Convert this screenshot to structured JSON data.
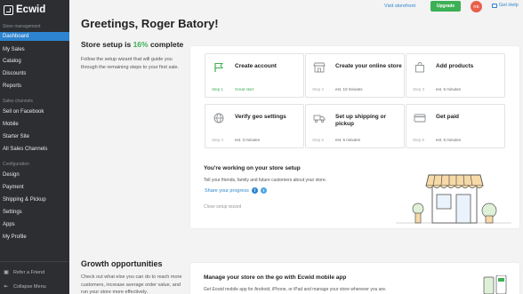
{
  "sidebar": {
    "brand": "Ecwid",
    "sections": {
      "store_management": "Store management",
      "sales_channels": "Sales channels",
      "configuration": "Configuration"
    },
    "items": [
      {
        "label": "Dashboard",
        "active": true
      },
      {
        "label": "My Sales"
      },
      {
        "label": "Catalog"
      },
      {
        "label": "Discounts"
      },
      {
        "label": "Reports"
      },
      {
        "label": "Sell on Facebook"
      },
      {
        "label": "Mobile"
      },
      {
        "label": "Starter Site"
      },
      {
        "label": "All Sales Channels"
      },
      {
        "label": "Design"
      },
      {
        "label": "Payment"
      },
      {
        "label": "Shipping & Pickup"
      },
      {
        "label": "Settings"
      },
      {
        "label": "Apps"
      },
      {
        "label": "My Profile"
      }
    ],
    "refer_friend": "Refer a Friend",
    "collapse_menu": "Collapse Menu"
  },
  "topbar": {
    "visit_storefront": "Visit storefront",
    "upgrade": "Upgrade",
    "avatar_initials": "RB",
    "get_help": "Get Help"
  },
  "greeting": "Greetings, Roger Batory!",
  "setup": {
    "title_prefix": "Store setup is ",
    "percent": "16%",
    "title_suffix": " complete",
    "description": "Follow the setup wizard that will guide you through the remaining steps to your first sale.",
    "steps": [
      {
        "icon": "flag-icon",
        "title": "Create account",
        "num": "Step 1",
        "meta": "Great start",
        "done": true
      },
      {
        "icon": "storefront-icon",
        "title": "Create your online store",
        "num": "Step 2",
        "meta": "est. 10 minutes",
        "done": false
      },
      {
        "icon": "bag-icon",
        "title": "Add products",
        "num": "Step 3",
        "meta": "est. 5 minutes",
        "done": false
      },
      {
        "icon": "globe-icon",
        "title": "Verify geo settings",
        "num": "Step 4",
        "meta": "est. 3 minutes",
        "done": false
      },
      {
        "icon": "truck-icon",
        "title": "Set up shipping or pickup",
        "num": "Step 5",
        "meta": "est. 5 minutes",
        "done": false
      },
      {
        "icon": "card-icon",
        "title": "Get paid",
        "num": "Step 6",
        "meta": "est. 5 minutes",
        "done": false
      }
    ],
    "working_title": "You're working on your store setup",
    "working_desc": "Tell your friends, family and future customers about your store.",
    "share_label": "Share your progress",
    "close_wizard": "Close setup wizard"
  },
  "growth": {
    "title": "Growth opportunities",
    "description": "Check out what else you can do to reach more customers, increase average order value, and run your store more effectively.",
    "mobile_title": "Manage your store on the go with Ecwid mobile app",
    "mobile_desc": "Get Ecwid mobile app for Android, iPhone, or iPad and manage your store wherever you are."
  },
  "colors": {
    "sidebar_bg": "#2c2e31",
    "active": "#2d84d0",
    "success": "#3cb054",
    "link": "#2d84d0"
  }
}
